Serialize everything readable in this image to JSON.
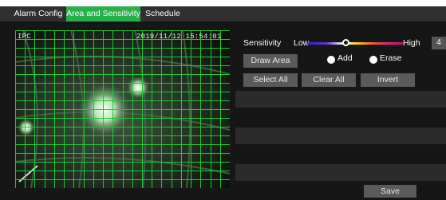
{
  "tabs": [
    {
      "label": "Alarm Config",
      "active": false
    },
    {
      "label": "Area and Sensitivity",
      "active": true
    },
    {
      "label": "Schedule",
      "active": false
    }
  ],
  "preview": {
    "channel_label": "IPC",
    "timestamp": "2019/11/12 15:54:01",
    "grid_color": "#22c63a"
  },
  "sensitivity": {
    "label": "Sensitivity",
    "low_label": "Low",
    "high_label": "High",
    "value": "4",
    "level_fraction": 0.4
  },
  "actions": {
    "draw_area": "Draw Area",
    "add_label": "Add",
    "erase_label": "Erase",
    "select_all": "Select All",
    "clear_all": "Clear All",
    "invert": "Invert",
    "save": "Save"
  },
  "colors": {
    "active_tab": "#27b04a",
    "panel_bg": "#161616",
    "button_bg": "#5a5a5a"
  }
}
